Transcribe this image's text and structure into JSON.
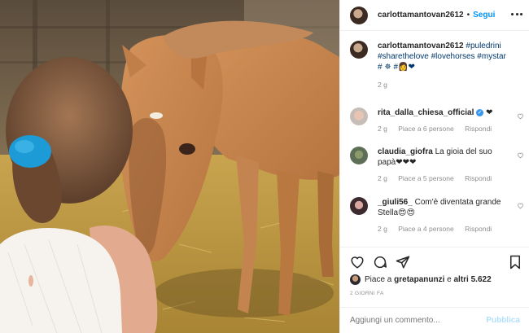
{
  "post": {
    "username": "carlottamantovan2612",
    "follow_label": "Segui",
    "separator": "•"
  },
  "caption": {
    "username": "carlottamantovan2612",
    "hashtags": "#puledrini #sharethelove #lovehorses #mystar #",
    "emojis": "✵ #👩❤",
    "time": "2 g"
  },
  "comments": [
    {
      "username": "rita_dalla_chiesa_official",
      "text": " ❤",
      "time": "2 g",
      "likes": "Piace a 6 persone",
      "reply": "Rispondi",
      "verified": true
    },
    {
      "username": "claudia_giofra",
      "text": " La gioia del suo papà❤❤❤",
      "time": "2 g",
      "likes": "Piace a 5 persone",
      "reply": "Rispondi"
    },
    {
      "username": "_giuli56_",
      "text": " Com'è diventata grande Stella😍😍",
      "time": "2 g",
      "likes": "Piace a 4 persone",
      "reply": "Rispondi"
    }
  ],
  "likes": {
    "prefix": "Piace a ",
    "user": "gretapanunzi",
    "mid": " e ",
    "others": "altri 5.622"
  },
  "date_label": "2 GIORNI FA",
  "add_comment": {
    "placeholder": "Aggiungi un commento...",
    "publish_label": "Pubblica"
  }
}
